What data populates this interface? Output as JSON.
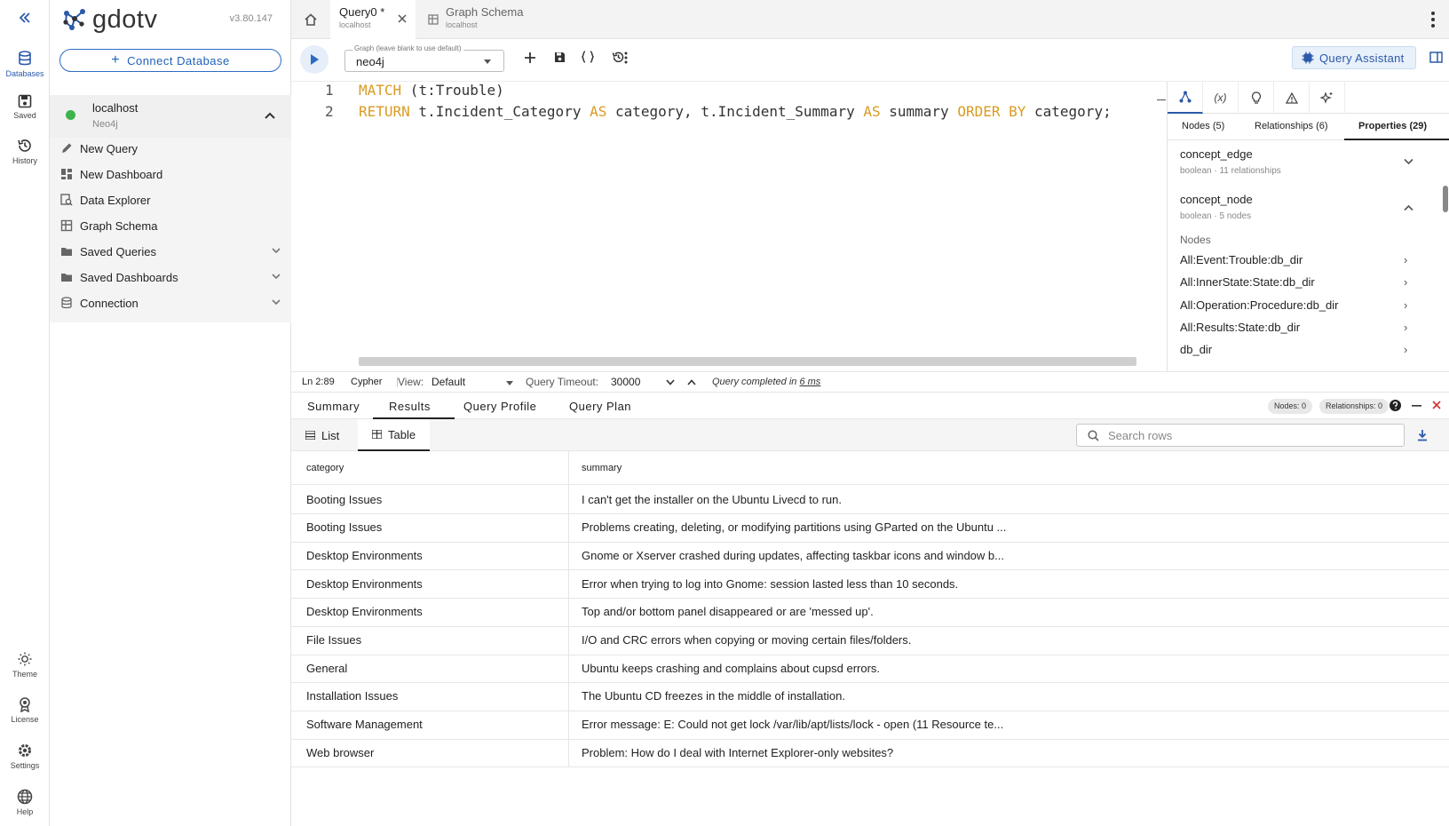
{
  "rail": {
    "collapse_label": "",
    "databases": "Databases",
    "saved": "Saved",
    "history": "History",
    "theme": "Theme",
    "license": "License",
    "settings": "Settings",
    "help": "Help"
  },
  "sidebar": {
    "logo": "gdotv",
    "version": "v3.80.147",
    "connect_button": "Connect Database",
    "connection": {
      "name": "localhost",
      "type": "Neo4j"
    },
    "items": [
      {
        "label": "New Query",
        "icon": "pencil-icon"
      },
      {
        "label": "New Dashboard",
        "icon": "dashboard-icon"
      },
      {
        "label": "Data Explorer",
        "icon": "explorer-icon"
      },
      {
        "label": "Graph Schema",
        "icon": "schema-icon"
      },
      {
        "label": "Saved Queries",
        "icon": "folder-icon"
      },
      {
        "label": "Saved Dashboards",
        "icon": "folder-icon"
      },
      {
        "label": "Connection",
        "icon": "database-icon"
      }
    ]
  },
  "tabs": [
    {
      "title": "Query0 *",
      "subtitle": "localhost"
    },
    {
      "title": "Graph Schema",
      "subtitle": "localhost"
    }
  ],
  "toolbar": {
    "graph_label": "Graph (leave blank to use default)",
    "graph_value": "neo4j",
    "query_assistant": "Query Assistant"
  },
  "editor": {
    "lines": [
      {
        "num": "1",
        "parts": [
          {
            "t": "MATCH",
            "kw": true
          },
          {
            "t": " (t:Trouble)",
            "kw": false
          }
        ]
      },
      {
        "num": "2",
        "parts": [
          {
            "t": "RETURN",
            "kw": true
          },
          {
            "t": " t.Incident_Category ",
            "kw": false
          },
          {
            "t": "AS",
            "kw": true
          },
          {
            "t": " category, t.Incident_Summary ",
            "kw": false
          },
          {
            "t": "AS",
            "kw": true
          },
          {
            "t": " summary ",
            "kw": false
          },
          {
            "t": "ORDER BY",
            "kw": true
          },
          {
            "t": " category;",
            "kw": false
          }
        ]
      }
    ]
  },
  "right_panel": {
    "icons": [
      "graph-icon",
      "variable-icon",
      "bulb-icon",
      "warning-icon",
      "sparkle-icon"
    ],
    "icon_texts": {
      "variable": "(x)"
    },
    "tabs": {
      "nodes": "Nodes (5)",
      "relationships": "Relationships (6)",
      "properties": "Properties (29)"
    },
    "properties": [
      {
        "name": "concept_edge",
        "meta": "boolean · 11 relationships"
      },
      {
        "name": "concept_node",
        "meta": "boolean · 5 nodes"
      }
    ],
    "nodes_heading": "Nodes",
    "nodes": [
      "All:Event:Trouble:db_dir",
      "All:InnerState:State:db_dir",
      "All:Operation:Procedure:db_dir",
      "All:Results:State:db_dir",
      "db_dir"
    ]
  },
  "status": {
    "position": "Ln 2:89",
    "language": "Cypher",
    "view_label": "View:",
    "view_value": "Default",
    "timeout_label": "Query Timeout:",
    "timeout_value": "30000",
    "completed_text": "Query completed in",
    "completed_time": "6 ms"
  },
  "results": {
    "tabs": [
      "Summary",
      "Results",
      "Query Profile",
      "Query Plan"
    ],
    "active_tab": "Results",
    "badges": {
      "nodes": "Nodes: 0",
      "relationships": "Relationships: 0"
    },
    "view_tabs": {
      "list": "List",
      "table": "Table"
    },
    "search_placeholder": "Search rows",
    "columns": [
      "category",
      "summary"
    ],
    "rows": [
      [
        "Booting Issues",
        "I can't get the installer on the Ubuntu Livecd to run."
      ],
      [
        "Booting Issues",
        "Problems creating, deleting, or modifying partitions using GParted on the Ubuntu ..."
      ],
      [
        "Desktop Environments",
        "Gnome or Xserver crashed during updates, affecting taskbar icons and window b..."
      ],
      [
        "Desktop Environments",
        "Error when trying to log into Gnome: session lasted less than 10 seconds."
      ],
      [
        "Desktop Environments",
        "Top and/or bottom panel disappeared or are 'messed up'."
      ],
      [
        "File Issues",
        "I/O and CRC errors when copying or moving certain files/folders."
      ],
      [
        "General",
        "Ubuntu keeps crashing and complains about cupsd errors."
      ],
      [
        "Installation Issues",
        "The Ubuntu CD freezes in the middle of installation."
      ],
      [
        "Software Management",
        "Error message: E: Could not get lock /var/lib/apt/lists/lock - open (11 Resource te..."
      ],
      [
        "Web browser",
        "Problem: How do I deal with Internet Explorer-only websites?"
      ]
    ]
  },
  "colors": {
    "accent": "#2b5aa8",
    "keyword": "#d99b24",
    "connected": "#3cb44b"
  }
}
